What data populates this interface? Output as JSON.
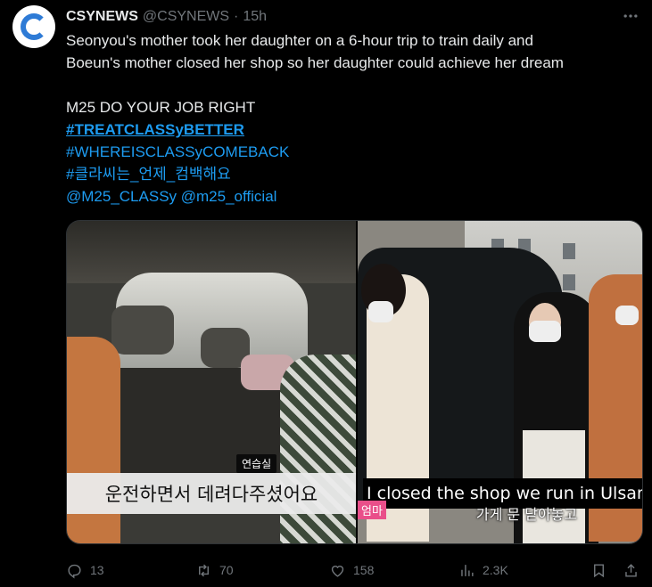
{
  "tweet": {
    "display_name": "CSYNEWS",
    "handle": "@CSYNEWS",
    "separator": "·",
    "time": "15h",
    "text_line1": "Seonyou's mother took her daughter on a 6-hour trip to train daily and",
    "text_line2": "Boeun's mother closed her shop so her daughter could achieve her dream",
    "text_line3": "M25 DO YOUR JOB RIGHT",
    "hashtag1": "#TREATCLASSyBETTER",
    "hashtag2": "#WHEREISCLASSyCOMEBACK",
    "hashtag3": "#클라씨는_언제_컴백해요",
    "mention1": "@M25_CLASSy",
    "mention2": "@m25_official"
  },
  "media": {
    "left": {
      "room_label": "연습실",
      "subtitle_kr": "운전하면서 데려다주셨어요"
    },
    "right": {
      "subtitle_en": "I closed the shop we run in Ulsan",
      "tag": "엄마",
      "subtitle_kr": "가게 문 닫아놓고"
    }
  },
  "actions": {
    "replies": "13",
    "reposts": "70",
    "likes": "158",
    "views": "2.3K"
  },
  "colors": {
    "background": "#000000",
    "text": "#e7e9ea",
    "muted": "#71767b",
    "link": "#1d9bf0"
  }
}
